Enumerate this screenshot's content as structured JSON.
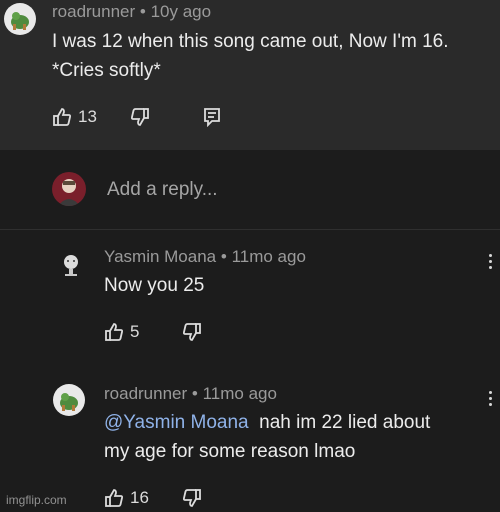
{
  "comment": {
    "author": "roadrunner",
    "sep": "•",
    "age": "10y ago",
    "text": "I was 12 when this song came out, Now I'm 16. *Cries softly*",
    "likes": "13"
  },
  "reply_box": {
    "placeholder": "Add a reply..."
  },
  "replies": [
    {
      "author": "Yasmin Moana",
      "sep": "•",
      "age": "11mo ago",
      "text": "Now you 25",
      "likes": "5"
    },
    {
      "author": "roadrunner",
      "sep": "•",
      "age": "11mo ago",
      "mention": "@Yasmin Moana",
      "text_first": "nah im 22 lied about",
      "text_second": "my age for some reason lmao",
      "likes": "16"
    }
  ],
  "watermark": "imgflip.com",
  "colors": {
    "mention": "#8fb2e8",
    "background": "#1c1c1c",
    "top_panel": "#2a2a2a"
  }
}
